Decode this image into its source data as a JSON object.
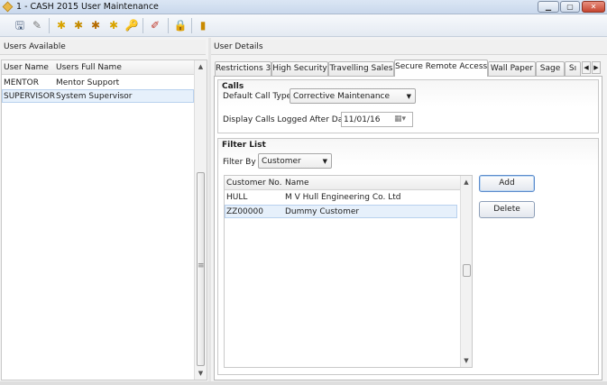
{
  "window": {
    "title": "1 - CASH 2015 User Maintenance",
    "minimize_label": "▁",
    "maximize_label": "▢",
    "close_label": "✕"
  },
  "toolbar": {
    "buttons": [
      {
        "name": "save-icon",
        "glyph": "🖫",
        "color": "#4a5f7d"
      },
      {
        "name": "cancel-edit-icon",
        "glyph": "✎",
        "color": "#7a7a7a"
      },
      {
        "name": "user-add-icon",
        "glyph": "✱",
        "color": "#d9a400"
      },
      {
        "name": "user-edit-icon",
        "glyph": "✱",
        "color": "#c48b00"
      },
      {
        "name": "user-group-icon",
        "glyph": "✱",
        "color": "#b56b00"
      },
      {
        "name": "user-delete-icon",
        "glyph": "✱",
        "color": "#d9a400"
      },
      {
        "name": "key-icon",
        "glyph": "🔑",
        "color": "#b08a2e"
      },
      {
        "name": "pen-icon",
        "glyph": "✐",
        "color": "#c0392b"
      },
      {
        "name": "lock-icon",
        "glyph": "🔒",
        "color": "#9a9a9a"
      },
      {
        "name": "exit-door-icon",
        "glyph": "▮",
        "color": "#c98a00"
      }
    ]
  },
  "users_pane": {
    "header": "Users Available",
    "columns": [
      "User Name",
      "Users Full Name"
    ],
    "rows": [
      {
        "user_name": "MENTOR",
        "full_name": "Mentor Support"
      },
      {
        "user_name": "SUPERVISOR",
        "full_name": "System Supervisor"
      }
    ],
    "selected_index": 1
  },
  "details_pane": {
    "header": "User Details",
    "tabs": [
      {
        "label": "Restrictions 3"
      },
      {
        "label": "High Security"
      },
      {
        "label": "Travelling Sales"
      },
      {
        "label": "Secure Remote Access"
      },
      {
        "label": "Wall Paper"
      },
      {
        "label": "Sage"
      },
      {
        "label": "Sı"
      }
    ],
    "active_tab_index": 3,
    "calls": {
      "title": "Calls",
      "default_call_type_label": "Default Call Type",
      "default_call_type_value": "Corrective Maintenance",
      "display_after_label": "Display Calls Logged After Date",
      "display_after_value": "11/01/16"
    },
    "filter": {
      "title": "Filter List",
      "filter_by_label": "Filter By",
      "filter_by_value": "Customer",
      "columns": [
        "Customer No.",
        "Name"
      ],
      "rows": [
        {
          "customer_no": "HULL",
          "name": "M V Hull Engineering Co. Ltd"
        },
        {
          "customer_no": "ZZ00000",
          "name": "Dummy Customer"
        }
      ],
      "selected_index": 1,
      "add_label": "Add",
      "delete_label": "Delete"
    }
  },
  "colors": {
    "selection": "#e6f0fb",
    "selection_border": "#b8d1ee",
    "close_button": "#c6452f"
  }
}
